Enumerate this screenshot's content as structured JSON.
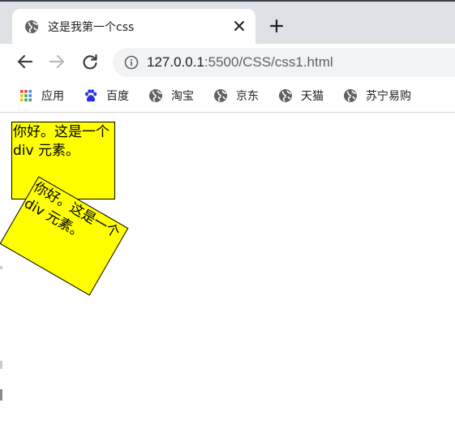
{
  "browser": {
    "tab": {
      "title": "这是我第一个css",
      "icon": "globe-icon",
      "close_icon": "close-icon"
    },
    "new_tab_icon": "plus-icon",
    "toolbar": {
      "back_icon": "arrow-left-icon",
      "forward_icon": "arrow-right-icon",
      "reload_icon": "reload-icon",
      "info_icon": "info-icon",
      "url_host": "127.0.0.1",
      "url_rest": ":5500/CSS/css1.html"
    },
    "bookmarks": [
      {
        "label": "应用",
        "icon": "apps-grid-icon"
      },
      {
        "label": "百度",
        "icon": "baidu-paw-icon"
      },
      {
        "label": "淘宝",
        "icon": "globe-icon"
      },
      {
        "label": "京东",
        "icon": "globe-icon"
      },
      {
        "label": "天猫",
        "icon": "globe-icon"
      },
      {
        "label": "苏宁易购",
        "icon": "globe-icon"
      }
    ]
  },
  "page": {
    "box1": {
      "text": "你好。这是一个 div 元素。"
    },
    "box2": {
      "text": "你好。这是一个 div 元素。",
      "rotation_deg": 30
    },
    "colors": {
      "box_fill": "#ffff00",
      "box_border": "#000000"
    }
  }
}
